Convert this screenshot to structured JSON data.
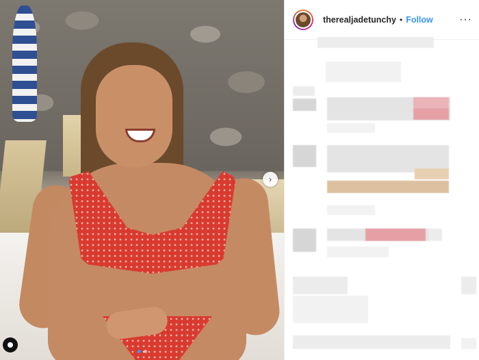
{
  "post": {
    "username": "therealjadetunchy",
    "separator": "•",
    "follow_label": "Follow",
    "more_label": "···"
  },
  "photo": {
    "next_label": "›",
    "slide_count": 2,
    "active_slide": 1
  }
}
